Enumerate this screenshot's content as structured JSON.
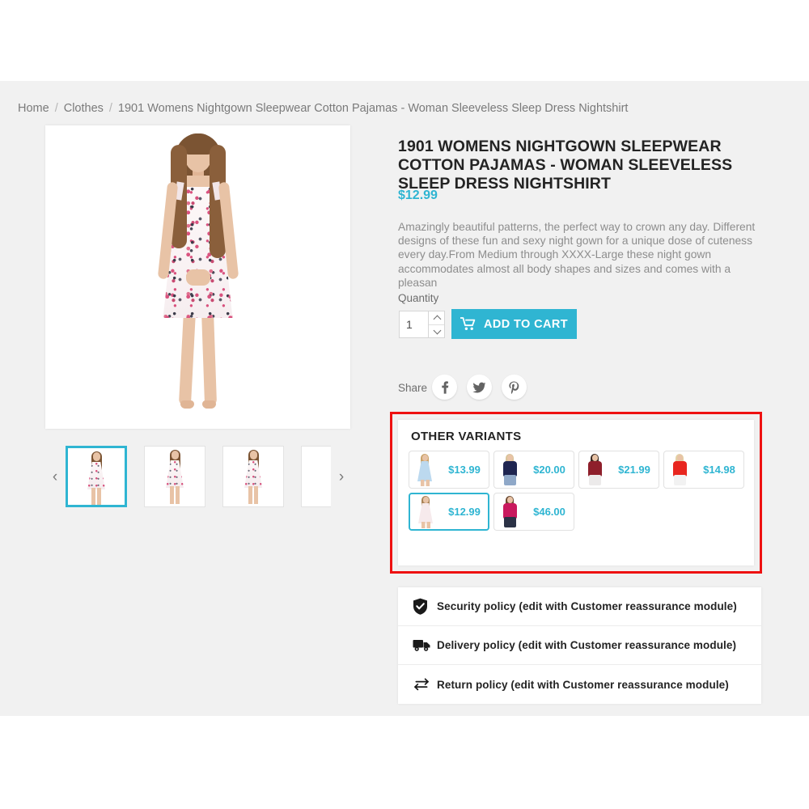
{
  "breadcrumb": {
    "items": [
      {
        "label": "Home"
      },
      {
        "label": "Clothes"
      },
      {
        "label": "1901 Womens Nightgown Sleepwear Cotton Pajamas - Woman Sleeveless Sleep Dress Nightshirt"
      }
    ],
    "separator": "/"
  },
  "product": {
    "title": "1901 WOMENS NIGHTGOWN SLEEPWEAR COTTON PAJAMAS - WOMAN SLEEVELESS SLEEP DRESS NIGHTSHIRT",
    "price": "$12.99",
    "description": "Amazingly beautiful patterns, the perfect way to crown any day. Different designs of these fun and sexy night gown for a unique dose of cuteness every day.From Medium through XXXX-Large these night gown accommodates almost all body shapes and sizes and comes with a pleasan"
  },
  "gallery": {
    "prev_icon": "chevron-left-icon",
    "next_icon": "chevron-right-icon",
    "thumbnails": [
      {
        "alt": "nightgown front view",
        "selected": true
      },
      {
        "alt": "nightgown side view",
        "selected": false
      },
      {
        "alt": "nightgown three quarter view",
        "selected": false
      },
      {
        "alt": "nightgown back view",
        "selected": false
      }
    ]
  },
  "purchase": {
    "quantity_label": "Quantity",
    "quantity_value": "1",
    "quantity_up_icon": "chevron-up-icon",
    "quantity_down_icon": "chevron-down-icon",
    "add_to_cart_label": "ADD TO CART",
    "cart_icon": "shopping-cart-icon",
    "accent_color": "#2fb5d2"
  },
  "share": {
    "label": "Share",
    "networks": [
      {
        "name": "facebook-icon",
        "glyph": "f"
      },
      {
        "name": "twitter-icon",
        "glyph": "t"
      },
      {
        "name": "pinterest-icon",
        "glyph": "P"
      }
    ]
  },
  "variants": {
    "title": "OTHER VARIANTS",
    "highlight_color": "#ee1111",
    "items": [
      {
        "price": "$13.99",
        "selected": false,
        "style": "dress",
        "garment_color": "#bcd9ef",
        "accent_color": "#8fbfe0",
        "bottom_color": "",
        "hair_color": "#c9a36a"
      },
      {
        "price": "$20.00",
        "selected": false,
        "style": "top",
        "garment_color": "#1f2550",
        "accent_color": "#1f2550",
        "bottom_color": "#8fa8c8",
        "hair_color": "#d8c49a"
      },
      {
        "price": "$21.99",
        "selected": false,
        "style": "top",
        "garment_color": "#8e1f2b",
        "accent_color": "#8e1f2b",
        "bottom_color": "#eceaea",
        "hair_color": "#3a2a22"
      },
      {
        "price": "$14.98",
        "selected": false,
        "style": "top",
        "garment_color": "#e8261f",
        "accent_color": "#e8261f",
        "bottom_color": "#f2f2f2",
        "hair_color": "#e3d2a6"
      },
      {
        "price": "$12.99",
        "selected": true,
        "style": "dress",
        "garment_color": "#f6eaec",
        "accent_color": "#e3b9c6",
        "bottom_color": "",
        "hair_color": "#a98357"
      },
      {
        "price": "$46.00",
        "selected": false,
        "style": "top",
        "garment_color": "#c9195e",
        "accent_color": "#c9195e",
        "bottom_color": "#2b3246",
        "hair_color": "#6b4a32"
      }
    ]
  },
  "policies": [
    {
      "icon": "shield-check-icon",
      "text": "Security policy (edit with Customer reassurance module)"
    },
    {
      "icon": "truck-icon",
      "text": "Delivery policy (edit with Customer reassurance module)"
    },
    {
      "icon": "return-arrows-icon",
      "text": "Return policy (edit with Customer reassurance module)"
    }
  ]
}
